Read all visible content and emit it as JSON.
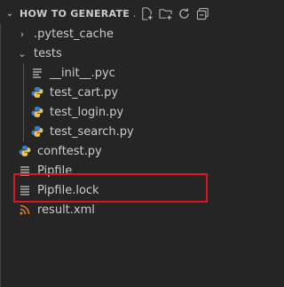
{
  "header": {
    "title": "HOW TO GENERATE ...",
    "actions": [
      "new-file-icon",
      "new-folder-icon",
      "refresh-icon",
      "collapse-all-icon"
    ]
  },
  "tree": {
    "items": [
      {
        "label": ".pytest_cache",
        "type": "folder",
        "state": "collapsed",
        "icon": "chevron-right-icon"
      },
      {
        "label": "tests",
        "type": "folder",
        "state": "expanded",
        "icon": "chevron-down-icon"
      },
      {
        "label": "__init__.pyc",
        "type": "file",
        "icon": "text-file-icon"
      },
      {
        "label": "test_cart.py",
        "type": "file",
        "icon": "python-icon"
      },
      {
        "label": "test_login.py",
        "type": "file",
        "icon": "python-icon"
      },
      {
        "label": "test_search.py",
        "type": "file",
        "icon": "python-icon"
      },
      {
        "label": "conftest.py",
        "type": "file",
        "icon": "python-icon"
      },
      {
        "label": "Pipfile",
        "type": "file",
        "icon": "pipfile-icon"
      },
      {
        "label": "Pipfile.lock",
        "type": "file",
        "icon": "pipfile-icon"
      },
      {
        "label": "result.xml",
        "type": "file",
        "icon": "rss-icon"
      }
    ]
  },
  "colors": {
    "background": "#252526",
    "text": "#cccccc",
    "python_blue": "#3b7bbf",
    "python_yellow": "#f2c14e",
    "rss_orange": "#e37933",
    "highlight_red": "#e0141e"
  }
}
